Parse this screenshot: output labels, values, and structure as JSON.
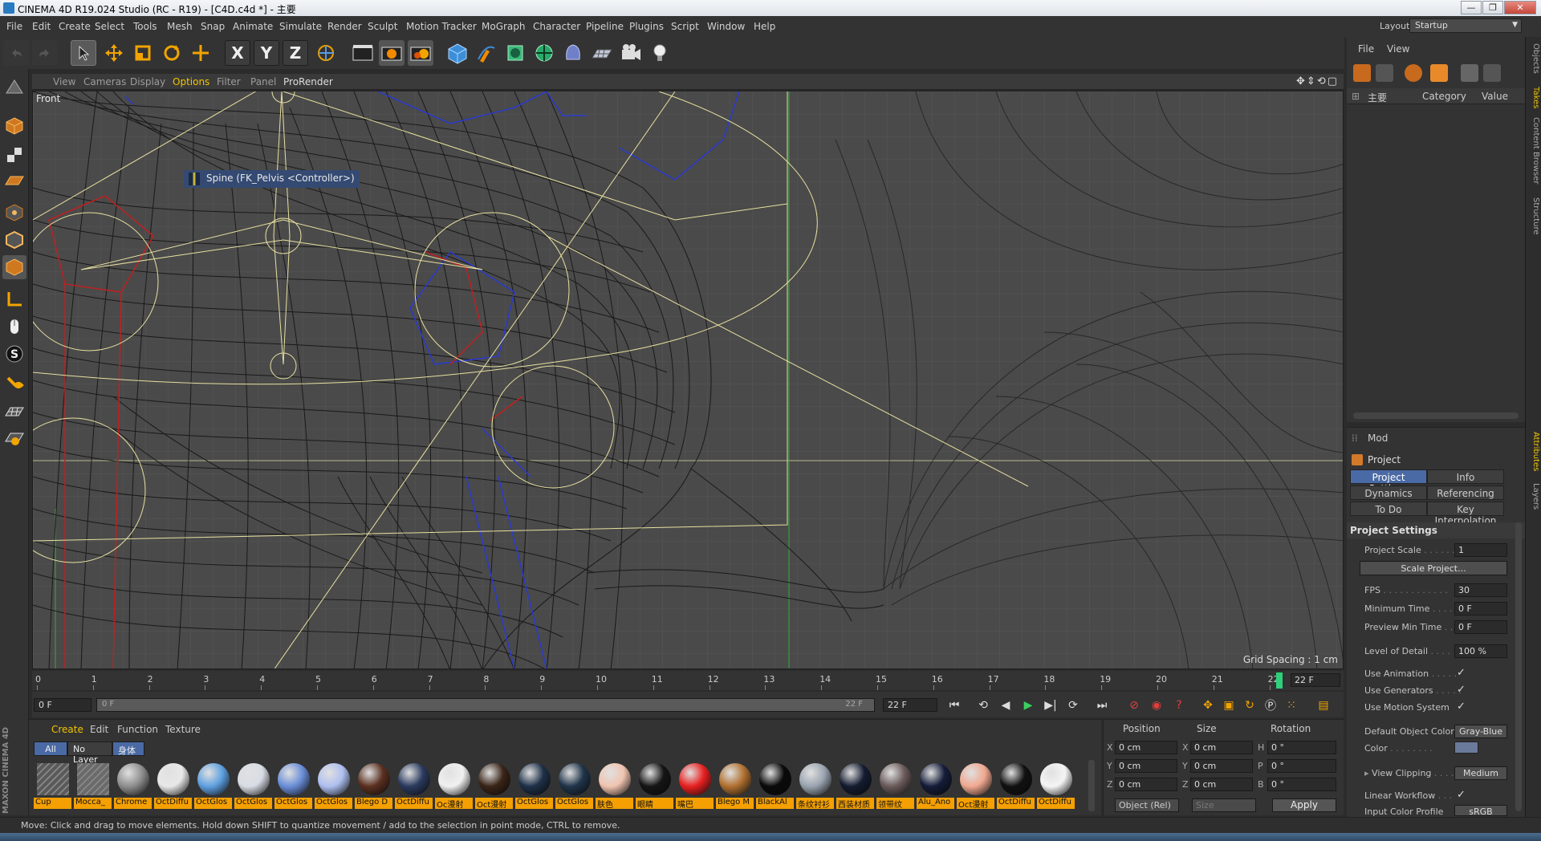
{
  "window": {
    "title": "CINEMA 4D R19.024 Studio (RC - R19) - [C4D.c4d *] - 主要"
  },
  "menu": [
    "File",
    "Edit",
    "Create",
    "Select",
    "Tools",
    "Mesh",
    "Snap",
    "Animate",
    "Simulate",
    "Render",
    "Sculpt",
    "Motion Tracker",
    "MoGraph",
    "Character",
    "Pipeline",
    "Plugins",
    "Script",
    "Window",
    "Help"
  ],
  "layout": {
    "label": "Layout:",
    "value": "Startup"
  },
  "toolbar": {
    "axis_x": "X",
    "axis_y": "Y",
    "axis_z": "Z"
  },
  "viewport": {
    "menu": [
      "View",
      "Cameras",
      "Display",
      "Options",
      "Filter",
      "Panel",
      "ProRender"
    ],
    "active_menu": "Options",
    "label": "Front",
    "tooltip": "Spine (FK_Pelvis <Controller>)",
    "grid_spacing": "Grid Spacing : 1 cm"
  },
  "timeline": {
    "ticks": [
      "0",
      "1",
      "2",
      "3",
      "4",
      "5",
      "6",
      "7",
      "8",
      "9",
      "10",
      "11",
      "12",
      "13",
      "14",
      "15",
      "16",
      "17",
      "18",
      "19",
      "20",
      "21",
      "22"
    ],
    "current_frame": "22 F"
  },
  "transport": {
    "start": "0 F",
    "range_start": "0 F",
    "range_end": "22 F",
    "end": "22 F"
  },
  "materials": {
    "menu": [
      "Create",
      "Edit",
      "Function",
      "Texture"
    ],
    "filters": [
      "All",
      "No Layer",
      "身体"
    ],
    "items": [
      {
        "name": "Cup",
        "color": "#5a5a5a"
      },
      {
        "name": "Mocca_",
        "color": "#6a6a6a"
      },
      {
        "name": "Chrome",
        "color": "#8e8e8e"
      },
      {
        "name": "OctDiffu",
        "color": "#e8e8e8"
      },
      {
        "name": "OctGlos",
        "color": "#5ea0e0"
      },
      {
        "name": "OctGlos",
        "color": "#d8dce4"
      },
      {
        "name": "OctGlos",
        "color": "#6a8ed8"
      },
      {
        "name": "OctGlos",
        "color": "#aebff0"
      },
      {
        "name": "Blego D",
        "color": "#5a3020"
      },
      {
        "name": "OctDiffu",
        "color": "#2a3a5e"
      },
      {
        "name": "Oc漫射",
        "color": "#f0f0f0"
      },
      {
        "name": "Oct漫射",
        "color": "#3a2418"
      },
      {
        "name": "OctGlos",
        "color": "#1e3048"
      },
      {
        "name": "OctGlos",
        "color": "#20344a"
      },
      {
        "name": "肤色",
        "color": "#f0c4b0"
      },
      {
        "name": "眼睛",
        "color": "#151515"
      },
      {
        "name": "嘴巴",
        "color": "#e82020"
      },
      {
        "name": "Blego M",
        "color": "#b07030"
      },
      {
        "name": "BlackAl",
        "color": "#0a0a0a"
      },
      {
        "name": "条纹衬衫",
        "color": "#9aa4b0"
      },
      {
        "name": "西装材质",
        "color": "#141c30"
      },
      {
        "name": "领带纹",
        "color": "#6a5a5a"
      },
      {
        "name": "Alu_Ano",
        "color": "#141c38"
      },
      {
        "name": "Oct漫射",
        "color": "#f0a890"
      },
      {
        "name": "OctDiffu",
        "color": "#111111"
      },
      {
        "name": "OctDiffu",
        "color": "#f4f4f4"
      }
    ]
  },
  "coordinates": {
    "headers": {
      "position": "Position",
      "size": "Size",
      "rotation": "Rotation"
    },
    "rows": [
      {
        "axis": "X",
        "pos": "0 cm",
        "size_axis": "X",
        "size": "0 cm",
        "rot_axis": "H",
        "rot": "0 °"
      },
      {
        "axis": "Y",
        "pos": "0 cm",
        "size_axis": "Y",
        "size": "0 cm",
        "rot_axis": "P",
        "rot": "0 °"
      },
      {
        "axis": "Z",
        "pos": "0 cm",
        "size_axis": "Z",
        "size": "0 cm",
        "rot_axis": "B",
        "rot": "0 °"
      }
    ],
    "mode": "Object (Rel)",
    "size_mode": "Size",
    "apply": "Apply"
  },
  "object_manager": {
    "menu": [
      "File",
      "View"
    ],
    "columns": {
      "name": "主要",
      "category": "Category",
      "value": "Value"
    }
  },
  "attributes": {
    "mode": "Mod",
    "title": "Project",
    "tabs": [
      "Project Settings",
      "Info",
      "Dynamics",
      "Referencing",
      "To Do",
      "Key Interpolation"
    ],
    "section": "Project Settings",
    "project_scale": {
      "label": "Project Scale",
      "value": "1"
    },
    "scale_button": "Scale Project...",
    "fps": {
      "label": "FPS",
      "value": "30"
    },
    "min_time": {
      "label": "Minimum Time",
      "value": "0 F"
    },
    "preview_min": {
      "label": "Preview Min Time",
      "value": "0 F"
    },
    "lod": {
      "label": "Level of Detail",
      "value": "100 %"
    },
    "use_animation": "Use Animation",
    "use_generators": "Use Generators",
    "use_motion": "Use Motion System",
    "default_color": {
      "label": "Default Object Color",
      "value": "Gray-Blue"
    },
    "color": {
      "label": "Color"
    },
    "view_clipping": {
      "label": "View Clipping",
      "value": "Medium"
    },
    "linear_workflow": "Linear Workflow",
    "input_color": {
      "label": "Input Color Profile",
      "value": "sRGB"
    },
    "check": "✓"
  },
  "vtabs": [
    "Objects",
    "Takes",
    "Content Browser",
    "Structure",
    "Attributes",
    "Layers"
  ],
  "brand": "MAXON CINEMA 4D",
  "status": "Move: Click and drag to move elements. Hold down SHIFT to quantize movement / add to the selection in point mode, CTRL to remove."
}
